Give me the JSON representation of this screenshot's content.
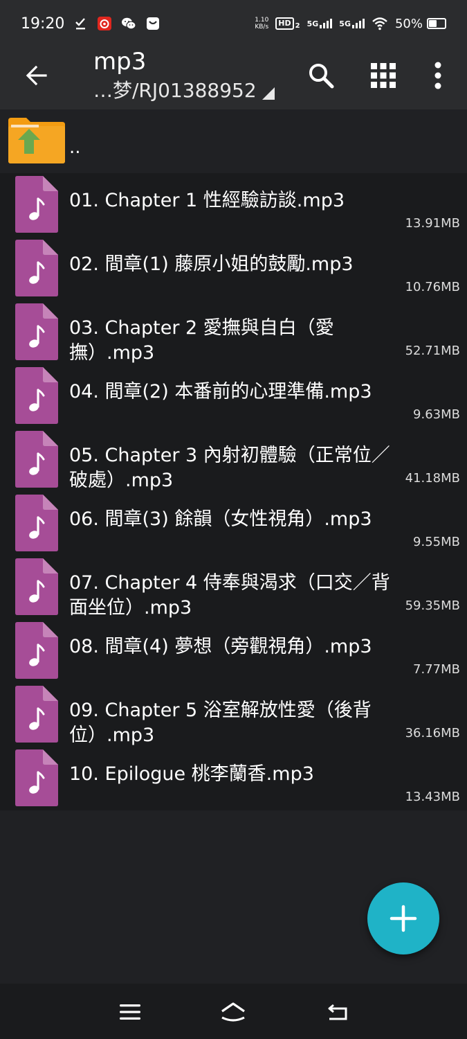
{
  "status_bar": {
    "time": "19:20",
    "net_speed_value": "1.10",
    "net_speed_unit": "KB/s",
    "hd_label": "HD",
    "hd_sub": "2",
    "signal1_label": "5G",
    "signal2_label": "5G",
    "battery_percent": "50%",
    "battery_level": 0.5,
    "icons": [
      "download-done-icon",
      "netease-music-icon",
      "wechat-icon",
      "message-icon",
      "wifi-icon"
    ]
  },
  "app_bar": {
    "title": "mp3",
    "path": "…梦/RJ01388952",
    "icons": [
      "back-arrow-icon",
      "search-icon",
      "grid-view-icon",
      "more-vert-icon"
    ]
  },
  "up_row": {
    "label": ".."
  },
  "files": [
    {
      "name": "01. Chapter 1 性經驗訪談.mp3",
      "size": "13.91MB"
    },
    {
      "name": "02. 間章(1) 藤原小姐的鼓勵.mp3",
      "size": "10.76MB"
    },
    {
      "name": "03. Chapter 2 愛撫與自白（愛撫）.mp3",
      "size": "52.71MB"
    },
    {
      "name": "04. 間章(2) 本番前的心理準備.mp3",
      "size": "9.63MB"
    },
    {
      "name": "05. Chapter 3 內射初體驗（正常位／破處）.mp3",
      "size": "41.18MB"
    },
    {
      "name": "06. 間章(3) 餘韻（女性視角）.mp3",
      "size": "9.55MB"
    },
    {
      "name": "07. Chapter 4 侍奉與渴求（口交／背面坐位）.mp3",
      "size": "59.35MB"
    },
    {
      "name": "08. 間章(4) 夢想（旁觀視角）.mp3",
      "size": "7.77MB"
    },
    {
      "name": "09. Chapter 5 浴室解放性愛（後背位）.mp3",
      "size": "36.16MB"
    },
    {
      "name": "10. Epilogue 桃李蘭香.mp3",
      "size": "13.43MB"
    }
  ],
  "colors": {
    "background": "#202124",
    "app_bar": "#2b2c2e",
    "file_icon": "#a64d97",
    "folder": "#f39c12",
    "up_arrow": "#6aa84f",
    "fab": "#1fb3c7"
  },
  "fab": {
    "icon": "plus-icon"
  },
  "nav_bar": {
    "icons": [
      "menu-icon",
      "home-icon",
      "back-icon"
    ]
  }
}
